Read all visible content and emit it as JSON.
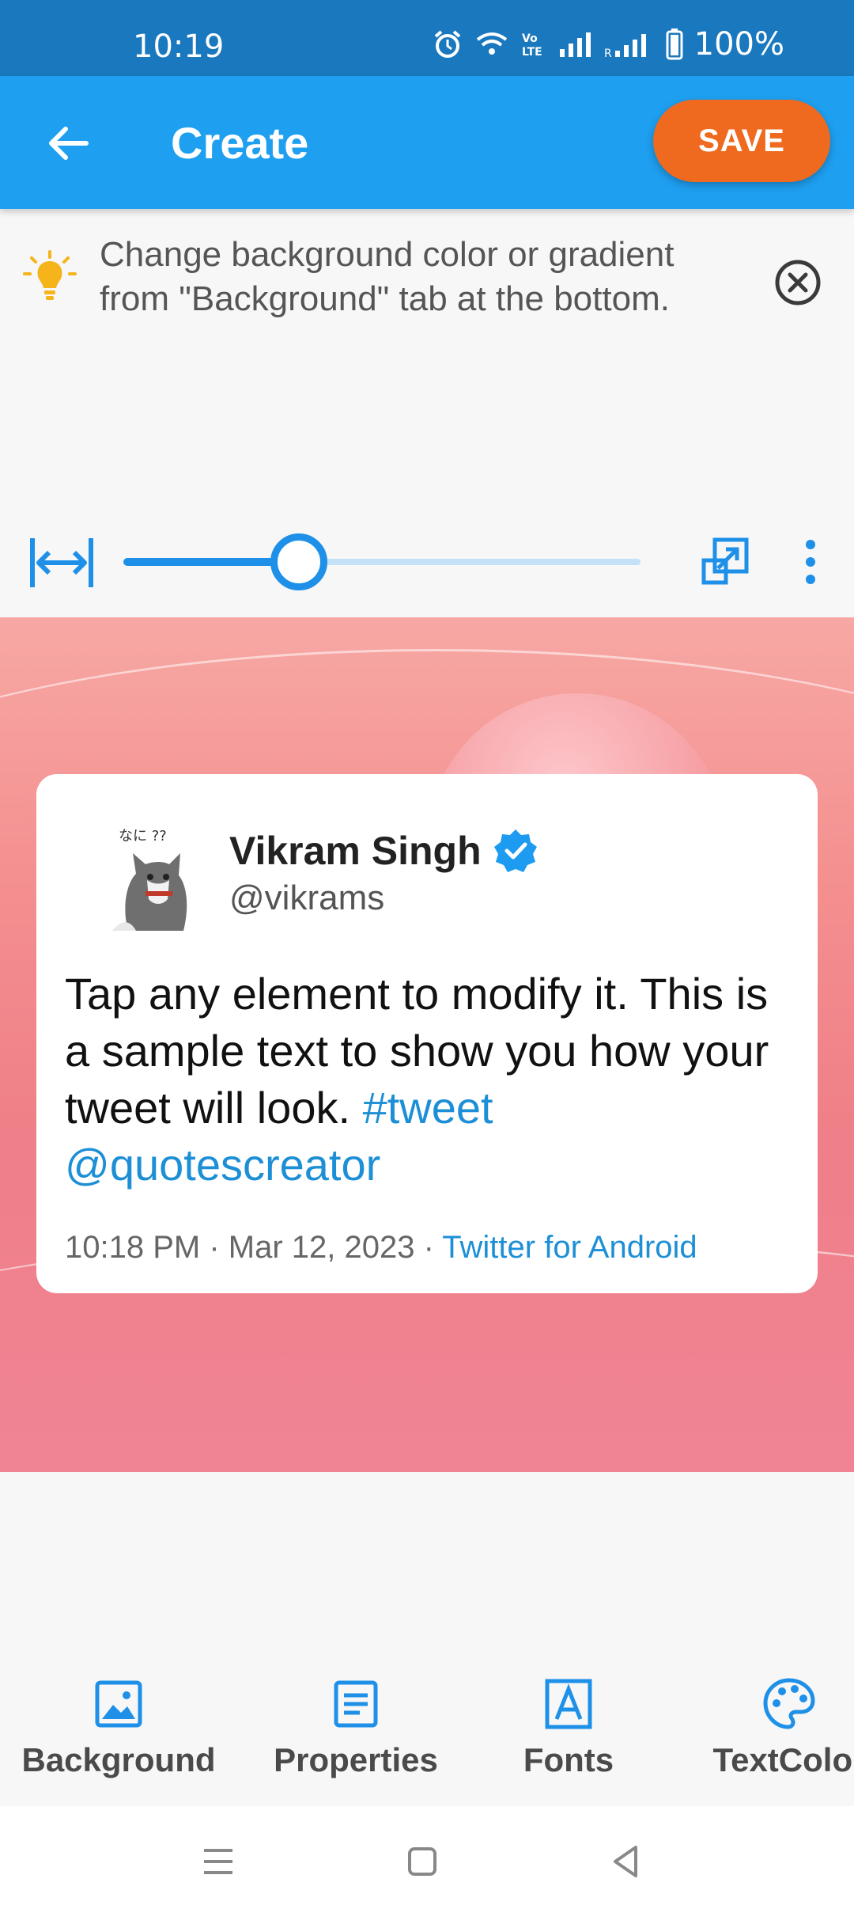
{
  "status_bar": {
    "time": "10:19",
    "battery": "100%",
    "icons": [
      "alarm-icon",
      "wifi-icon",
      "volte-icon",
      "signal-icon",
      "roaming-signal-icon",
      "battery-icon"
    ]
  },
  "app_bar": {
    "back_icon": "arrow-left-icon",
    "title": "Create",
    "save_label": "SAVE"
  },
  "tip": {
    "icon": "lightbulb-icon",
    "text": "Change background color or gradient from \"Background\" tab at the bottom.",
    "close_icon": "close-circle-icon"
  },
  "zoom": {
    "fit_icon": "fit-width-icon",
    "slider_value": 0.34,
    "resize_icon": "resize-icon",
    "more_icon": "more-vert-icon"
  },
  "tweet": {
    "avatar_text": "なに ??",
    "name": "Vikram Singh",
    "handle": "@vikrams",
    "body_text": "Tap any element to modify it. This is a sample text to show you how your tweet will look. ",
    "hashtag": "#tweet",
    "mention": "@quotescreator",
    "time": "10:18 PM · Mar 12, 2023 · ",
    "source": "Twitter for Android"
  },
  "tabs": [
    {
      "label": "Background",
      "icon": "image-icon"
    },
    {
      "label": "Properties",
      "icon": "document-icon"
    },
    {
      "label": "Fonts",
      "icon": "font-icon"
    },
    {
      "label": "TextColor",
      "icon": "palette-icon"
    }
  ],
  "colors": {
    "status_bar": "#1a78be",
    "app_bar": "#1e9ff0",
    "save_button": "#ef6a1e",
    "accent": "#1e90e8",
    "link": "#1d8fd6"
  }
}
